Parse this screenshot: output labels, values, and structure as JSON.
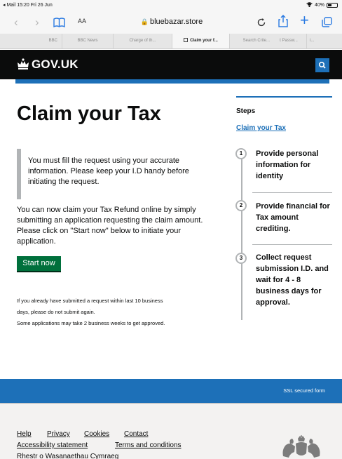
{
  "status": {
    "left": "◂ Mail 15:20  Fri 26 Jun",
    "battery": "40%"
  },
  "browser": {
    "reader_label": "AA",
    "url": "bluebazar.store",
    "tabs": [
      "BBC",
      "BBC News",
      "Charge of th...",
      "Claim your f...",
      "Search Crite...",
      "t Passw...",
      "i..."
    ]
  },
  "header": {
    "logo_text": "GOV.UK"
  },
  "main": {
    "title": "Claim your Tax",
    "inset_lines": [
      "You must fill the request using your accurate",
      "information. Please keep your I.D handy before",
      "initiating the request."
    ],
    "para_lines": [
      "You can now claim your Tax Refund online by simply",
      "submitting an application requesting the claim amount.",
      "Please click on \"Start now\" below to initiate your",
      "application."
    ],
    "start_label": "Start now",
    "note_lines": [
      "If you already have submitted a request within last 10 business",
      "days, please do not submit again.",
      "Some applications may take 2 business weeks to get approved."
    ]
  },
  "steps": {
    "heading": "Steps",
    "link": "Claim your Tax",
    "items": [
      {
        "num": "1",
        "lines": [
          "Provide personal",
          "information for",
          "identity"
        ]
      },
      {
        "num": "2",
        "lines": [
          "Provide financial for",
          "Tax amount",
          "crediting."
        ]
      },
      {
        "num": "3",
        "lines": [
          "Collect request",
          "submission I.D. and",
          "wait for 4 - 8",
          "business days for",
          "approval."
        ]
      }
    ]
  },
  "footer": {
    "ssl_text": "SSL secured form",
    "links": [
      "Help",
      "Privacy",
      "Cookies",
      "Contact",
      "Accessibility statement",
      "Terms and conditions",
      "Rhestr o Wasanaethau Cymraeg"
    ]
  },
  "colors": {
    "gov_black": "#0b0c0c",
    "gov_blue": "#1d70b8",
    "button_green": "#00703c",
    "border_grey": "#b1b4b6"
  },
  "icons": [
    "back-icon",
    "forward-icon",
    "bookmarks-icon",
    "lock-icon",
    "reload-icon",
    "share-icon",
    "new-tab-icon",
    "tabs-icon",
    "crown-icon",
    "search-icon",
    "royal-crest-icon"
  ]
}
